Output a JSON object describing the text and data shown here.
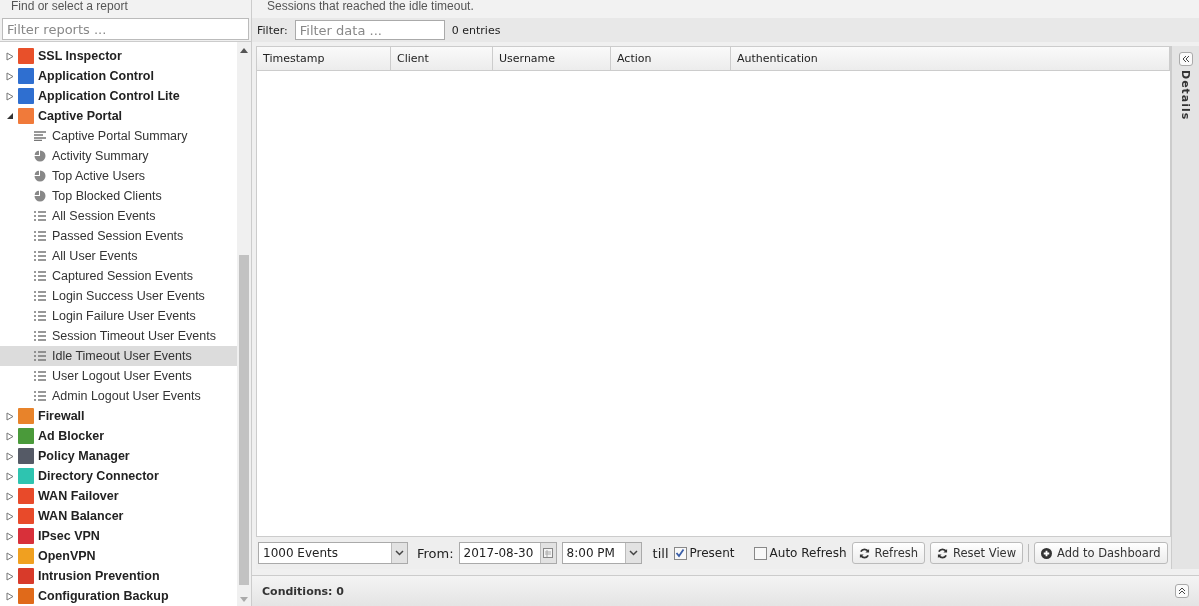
{
  "sidebar": {
    "title": "Find or select a report",
    "filter": {
      "placeholder": "Filter reports ..."
    },
    "items": [
      {
        "label": "SSL Inspector",
        "color": "#e8502a",
        "expanded": false
      },
      {
        "label": "Application Control",
        "color": "#2f6fd0",
        "expanded": false
      },
      {
        "label": "Application Control Lite",
        "color": "#2f6fd0",
        "expanded": false
      },
      {
        "label": "Captive Portal",
        "color": "#f07a3a",
        "expanded": true,
        "children": [
          {
            "label": "Captive Portal Summary",
            "kind": "summary",
            "selected": false
          },
          {
            "label": "Activity Summary",
            "kind": "pie",
            "selected": false
          },
          {
            "label": "Top Active Users",
            "kind": "pie",
            "selected": false
          },
          {
            "label": "Top Blocked Clients",
            "kind": "pie",
            "selected": false
          },
          {
            "label": "All Session Events",
            "kind": "list",
            "selected": false
          },
          {
            "label": "Passed Session Events",
            "kind": "list",
            "selected": false
          },
          {
            "label": "All User Events",
            "kind": "list",
            "selected": false
          },
          {
            "label": "Captured Session Events",
            "kind": "list",
            "selected": false
          },
          {
            "label": "Login Success User Events",
            "kind": "list",
            "selected": false
          },
          {
            "label": "Login Failure User Events",
            "kind": "list",
            "selected": false
          },
          {
            "label": "Session Timeout User Events",
            "kind": "list",
            "selected": false
          },
          {
            "label": "Idle Timeout User Events",
            "kind": "list",
            "selected": true
          },
          {
            "label": "User Logout User Events",
            "kind": "list",
            "selected": false
          },
          {
            "label": "Admin Logout User Events",
            "kind": "list",
            "selected": false
          }
        ]
      },
      {
        "label": "Firewall",
        "color": "#e8832a",
        "expanded": false
      },
      {
        "label": "Ad Blocker",
        "color": "#4a9a3a",
        "expanded": false
      },
      {
        "label": "Policy Manager",
        "color": "#555a66",
        "expanded": false
      },
      {
        "label": "Directory Connector",
        "color": "#2ec4b0",
        "expanded": false
      },
      {
        "label": "WAN Failover",
        "color": "#e84a2a",
        "expanded": false
      },
      {
        "label": "WAN Balancer",
        "color": "#e84a2a",
        "expanded": false
      },
      {
        "label": "IPsec VPN",
        "color": "#d8303a",
        "expanded": false
      },
      {
        "label": "OpenVPN",
        "color": "#f0a020",
        "expanded": false
      },
      {
        "label": "Intrusion Prevention",
        "color": "#d83a2a",
        "expanded": false
      },
      {
        "label": "Configuration Backup",
        "color": "#e06a1a",
        "expanded": false
      }
    ]
  },
  "report": {
    "description": "Sessions that reached the idle timeout.",
    "filter_label": "Filter:",
    "filter": {
      "placeholder": "Filter data ..."
    },
    "entries": "0 entries",
    "columns": [
      "Timestamp",
      "Client",
      "Username",
      "Action",
      "Authentication"
    ],
    "details_label": "Details",
    "toolbar": {
      "limit": "1000 Events",
      "from_label": "From:",
      "date": "2017-08-30",
      "time": "8:00 PM",
      "till_label": "till",
      "present": {
        "label": "Present",
        "checked": true
      },
      "auto_refresh": {
        "label": "Auto Refresh",
        "checked": false
      },
      "buttons": [
        {
          "label": "Refresh",
          "kind": "refresh"
        },
        {
          "label": "Reset View",
          "kind": "refresh"
        },
        {
          "label": "Add to Dashboard",
          "kind": "add"
        }
      ]
    },
    "conditions": "Conditions: 0"
  }
}
